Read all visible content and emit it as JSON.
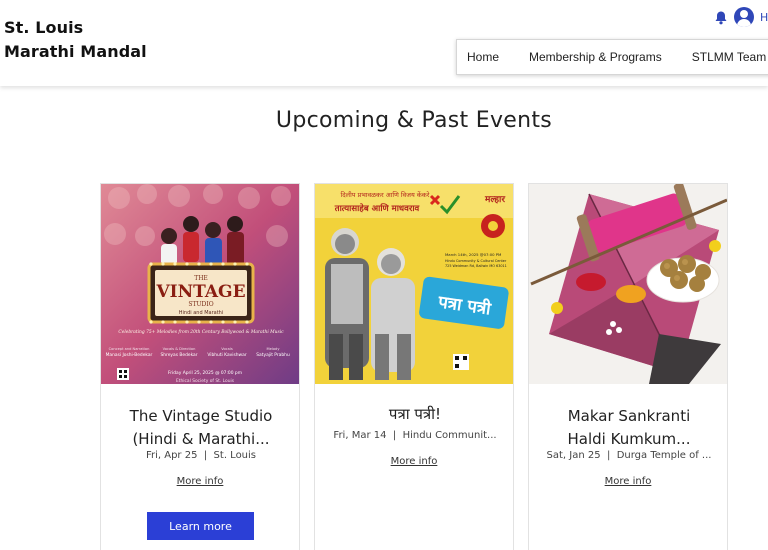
{
  "site": {
    "title_line1": "St. Louis",
    "title_line2": "Marathi Mandal"
  },
  "header": {
    "user_initial": "H"
  },
  "nav": {
    "items": [
      "Home",
      "Membership & Programs",
      "STLMM Team"
    ]
  },
  "heading": "Upcoming & Past Events",
  "colors": {
    "accent": "#2b3fd6",
    "icon_blue": "#2f47b8"
  },
  "icons": {
    "notifications": "bell-icon",
    "account": "user-avatar-icon"
  },
  "events": [
    {
      "title_line1": "The Vintage Studio",
      "title_line2": "(Hindi & Marathi...",
      "date": "Fri, Apr 25",
      "location": "St. Louis",
      "more_info": "More info",
      "button": "Learn more",
      "poster": {
        "title_big": "VINTAGE",
        "title_small": "THE",
        "studio": "STUDIO",
        "sub": "Hindi and Marathi",
        "tagline": "Celebrating 75+ Melodies from 20th Century Bollywood & Marathi Music",
        "credit1_role": "Concept and Narration",
        "credit1_name": "Manasi Joshi-Bedekar",
        "credit2_role": "Vocals & Direction",
        "credit2_name": "Shreyas Bedekar",
        "credit3_role": "Vocals",
        "credit3_name": "Vibhuti Kavishwar",
        "credit4_role": "Melody",
        "credit4_name": "Satyajit Prabhu",
        "date_line": "Friday April 25, 2025 @ 07:00 pm",
        "venue_line": "Ethical Society of St. Louis"
      }
    },
    {
      "title_line1": "पत्रा पत्री!",
      "date": "Fri, Mar 14",
      "location": "Hindu Communit...",
      "more_info": "More info",
      "poster": {
        "top1": "दिलीप प्रभावळकर आणि विजय केंकरे",
        "top2": "तात्यासाहेब आणि माधवराव",
        "logo": "मल्हार",
        "big": "पत्रा पत्री",
        "date_line": "March 14th, 2025 @07:00 PM",
        "venue1": "Hindu Community & Cultural Center",
        "venue2": "725 Weidman Rd, Ballwin MO 63011"
      }
    },
    {
      "title_line1": "Makar Sankranti",
      "title_line2": "Haldi Kumkum...",
      "date": "Sat, Jan 25",
      "location": "Durga Temple of ...",
      "more_info": "More info"
    }
  ]
}
